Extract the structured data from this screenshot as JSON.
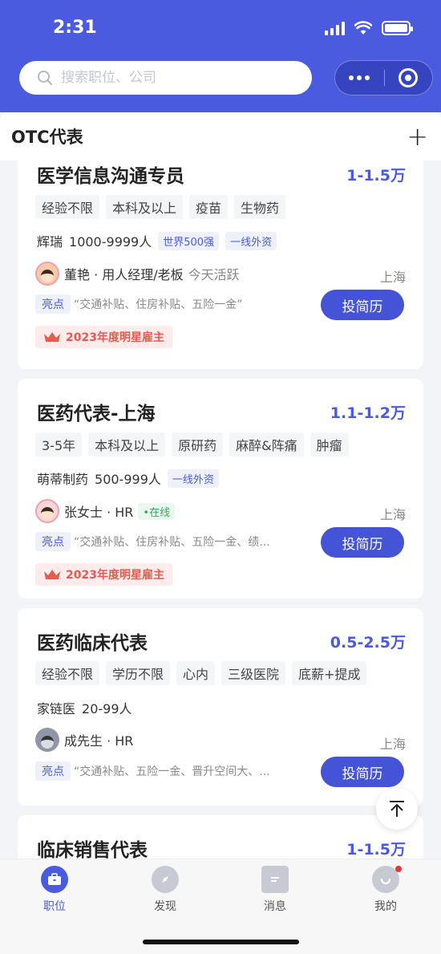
{
  "status_bar": {
    "time": "2:31"
  },
  "search": {
    "placeholder": "搜索职位、公司"
  },
  "tab": {
    "label": "OTC代表",
    "add_label": "+"
  },
  "jobs": [
    {
      "title": "医学信息沟通专员",
      "salary": "1-1.5万",
      "tags": [
        "经验不限",
        "本科及以上",
        "疫苗",
        "生物药"
      ],
      "company": "辉瑞",
      "size": "1000-9999人",
      "company_tags": [
        "世界500强",
        "一线外资"
      ],
      "recruiter": "董艳 · 用人经理/老板",
      "recruiter_status": "今天活跃",
      "location": "上海",
      "highlight_label": "亮点",
      "highlight": "“交通补贴、住房补贴、五险一金”",
      "apply_label": "投简历",
      "badge": "2023年度明星雇主"
    },
    {
      "title": "医药代表-上海",
      "salary": "1.1-1.2万",
      "tags": [
        "3-5年",
        "本科及以上",
        "原研药",
        "麻醉&阵痛",
        "肿瘤"
      ],
      "company": "萌蒂制药",
      "size": "500-999人",
      "company_tags": [
        "一线外资"
      ],
      "recruiter": "张女士 · HR",
      "recruiter_status": "•在线",
      "location": "上海",
      "highlight_label": "亮点",
      "highlight": "“交通补贴、住房补贴、五险一金、绩...",
      "apply_label": "投简历",
      "badge": "2023年度明星雇主"
    },
    {
      "title": "医药临床代表",
      "salary": "0.5-2.5万",
      "tags": [
        "经验不限",
        "学历不限",
        "心内",
        "三级医院",
        "底薪+提成"
      ],
      "company": "家链医",
      "size": "20-99人",
      "company_tags": [],
      "recruiter": "成先生 · HR",
      "recruiter_status": "",
      "location": "上海",
      "highlight_label": "亮点",
      "highlight": "“交通补贴、五险一金、晋升空间大、...",
      "apply_label": "投简历",
      "badge": ""
    },
    {
      "title": "临床销售代表",
      "salary": "1-1.5万"
    }
  ],
  "bottom_nav": [
    {
      "label": "职位",
      "icon": "briefcase-icon"
    },
    {
      "label": "发现",
      "icon": "compass-icon"
    },
    {
      "label": "消息",
      "icon": "message-icon"
    },
    {
      "label": "我的",
      "icon": "profile-icon"
    }
  ],
  "colors": {
    "brand": "#4a5be0",
    "badge_red": "#e65a50",
    "online_green": "#39a760"
  }
}
